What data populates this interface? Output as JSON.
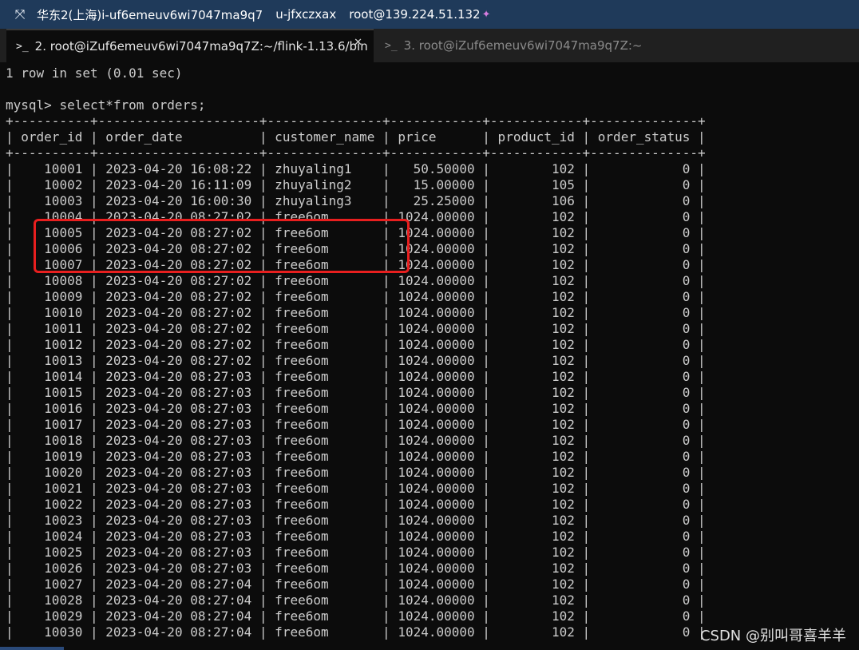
{
  "window": {
    "title_parts": [
      "华东2(上海)i-uf6emeuv6wi7047ma9q7",
      "u-jfxczxax",
      "root@139.224.51.132"
    ],
    "icon": "expand-arrows-icon"
  },
  "tabs": [
    {
      "label": "2. root@iZuf6emeuv6wi7047ma9q7Z:~/flink-1.13.6/bin",
      "active": true
    },
    {
      "label": "3. root@iZuf6emeuv6wi7047ma9q7Z:~",
      "active": false
    }
  ],
  "terminal": {
    "prev_result": "1 row in set (0.01 sec)",
    "prompt": "mysql>",
    "command": "select*from orders;",
    "table": {
      "columns": [
        "order_id",
        "order_date",
        "customer_name",
        "price",
        "product_id",
        "order_status"
      ],
      "rows": [
        [
          "10001",
          "2023-04-20 16:08:22",
          "zhuyaling1",
          "50.50000",
          "102",
          "0"
        ],
        [
          "10002",
          "2023-04-20 16:11:09",
          "zhuyaling2",
          "15.00000",
          "105",
          "0"
        ],
        [
          "10003",
          "2023-04-20 16:00:30",
          "zhuyaling3",
          "25.25000",
          "106",
          "0"
        ],
        [
          "10004",
          "2023-04-20 08:27:02",
          "free6om",
          "1024.00000",
          "102",
          "0"
        ],
        [
          "10005",
          "2023-04-20 08:27:02",
          "free6om",
          "1024.00000",
          "102",
          "0"
        ],
        [
          "10006",
          "2023-04-20 08:27:02",
          "free6om",
          "1024.00000",
          "102",
          "0"
        ],
        [
          "10007",
          "2023-04-20 08:27:02",
          "free6om",
          "1024.00000",
          "102",
          "0"
        ],
        [
          "10008",
          "2023-04-20 08:27:02",
          "free6om",
          "1024.00000",
          "102",
          "0"
        ],
        [
          "10009",
          "2023-04-20 08:27:02",
          "free6om",
          "1024.00000",
          "102",
          "0"
        ],
        [
          "10010",
          "2023-04-20 08:27:02",
          "free6om",
          "1024.00000",
          "102",
          "0"
        ],
        [
          "10011",
          "2023-04-20 08:27:02",
          "free6om",
          "1024.00000",
          "102",
          "0"
        ],
        [
          "10012",
          "2023-04-20 08:27:02",
          "free6om",
          "1024.00000",
          "102",
          "0"
        ],
        [
          "10013",
          "2023-04-20 08:27:02",
          "free6om",
          "1024.00000",
          "102",
          "0"
        ],
        [
          "10014",
          "2023-04-20 08:27:03",
          "free6om",
          "1024.00000",
          "102",
          "0"
        ],
        [
          "10015",
          "2023-04-20 08:27:03",
          "free6om",
          "1024.00000",
          "102",
          "0"
        ],
        [
          "10016",
          "2023-04-20 08:27:03",
          "free6om",
          "1024.00000",
          "102",
          "0"
        ],
        [
          "10017",
          "2023-04-20 08:27:03",
          "free6om",
          "1024.00000",
          "102",
          "0"
        ],
        [
          "10018",
          "2023-04-20 08:27:03",
          "free6om",
          "1024.00000",
          "102",
          "0"
        ],
        [
          "10019",
          "2023-04-20 08:27:03",
          "free6om",
          "1024.00000",
          "102",
          "0"
        ],
        [
          "10020",
          "2023-04-20 08:27:03",
          "free6om",
          "1024.00000",
          "102",
          "0"
        ],
        [
          "10021",
          "2023-04-20 08:27:03",
          "free6om",
          "1024.00000",
          "102",
          "0"
        ],
        [
          "10022",
          "2023-04-20 08:27:03",
          "free6om",
          "1024.00000",
          "102",
          "0"
        ],
        [
          "10023",
          "2023-04-20 08:27:03",
          "free6om",
          "1024.00000",
          "102",
          "0"
        ],
        [
          "10024",
          "2023-04-20 08:27:03",
          "free6om",
          "1024.00000",
          "102",
          "0"
        ],
        [
          "10025",
          "2023-04-20 08:27:03",
          "free6om",
          "1024.00000",
          "102",
          "0"
        ],
        [
          "10026",
          "2023-04-20 08:27:03",
          "free6om",
          "1024.00000",
          "102",
          "0"
        ],
        [
          "10027",
          "2023-04-20 08:27:04",
          "free6om",
          "1024.00000",
          "102",
          "0"
        ],
        [
          "10028",
          "2023-04-20 08:27:04",
          "free6om",
          "1024.00000",
          "102",
          "0"
        ],
        [
          "10029",
          "2023-04-20 08:27:04",
          "free6om",
          "1024.00000",
          "102",
          "0"
        ],
        [
          "10030",
          "2023-04-20 08:27:04",
          "free6om",
          "1024.00000",
          "102",
          "0"
        ]
      ]
    }
  },
  "watermark": "CSDN @别叫哥喜羊羊",
  "colors": {
    "titlebar": "#1f3a5a",
    "terminal_bg": "#0c0c0c",
    "terminal_fg": "#cccccc",
    "highlight": "#e81f1f"
  }
}
